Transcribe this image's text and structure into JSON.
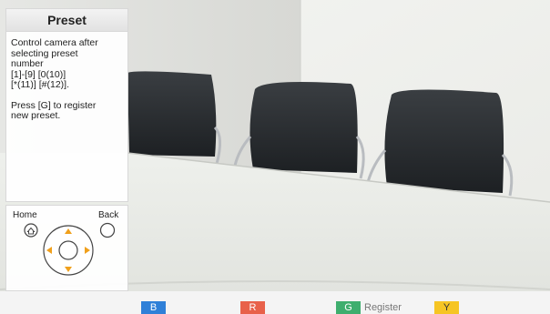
{
  "panel": {
    "title": "Preset",
    "instructions": [
      "Control camera after\nselecting preset\nnumber\n[1]-[9] [0(10)]\n[*(11)] [#(12)].",
      "Press [G] to register\nnew preset."
    ],
    "home_label": "Home",
    "back_label": "Back"
  },
  "keys": [
    {
      "letter": "B",
      "color": "#2f80d8",
      "text_color": "#ffffff"
    },
    {
      "letter": "R",
      "color": "#e8614a",
      "text_color": "#ffffff"
    },
    {
      "letter": "G",
      "color": "#3eae6e",
      "text_color": "#ffffff",
      "label": "Register"
    },
    {
      "letter": "Y",
      "color": "#f6c524",
      "text_color": "#333333"
    }
  ],
  "icons": {
    "home": "home-icon",
    "back": "back-button-icon",
    "dpad": "directional-pad-icon",
    "arrow_color": "#f0a01c"
  }
}
